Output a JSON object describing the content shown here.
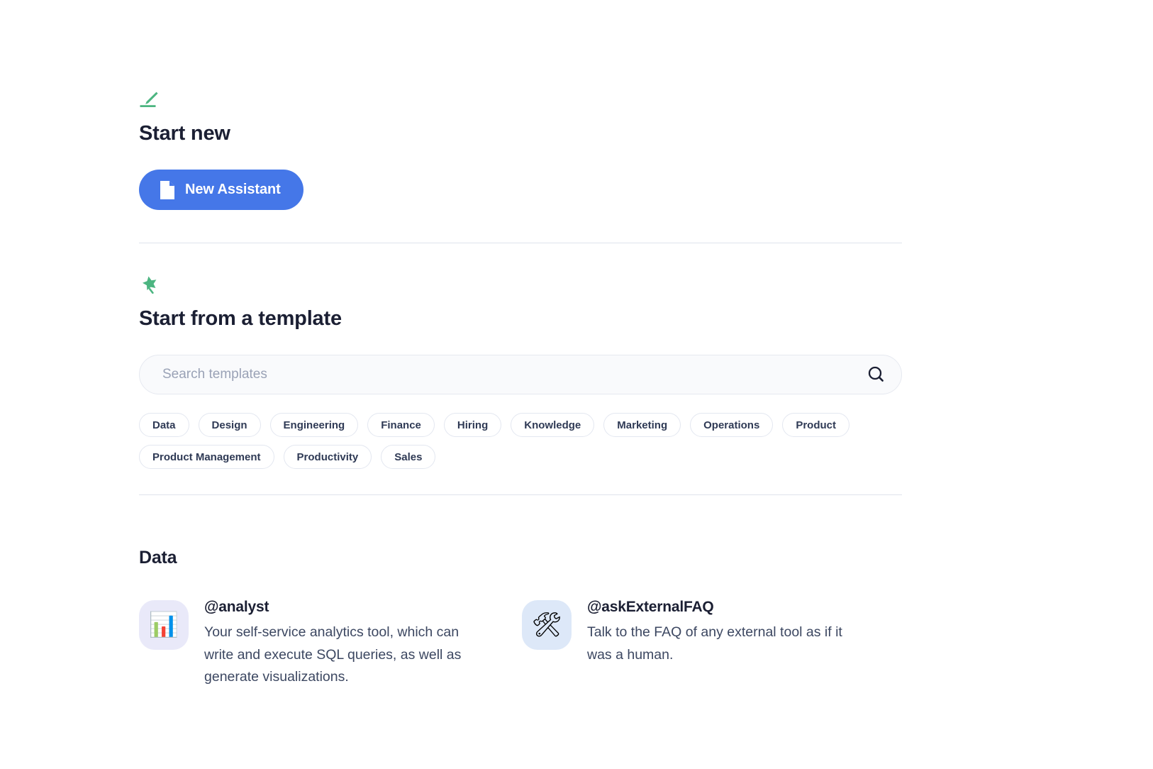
{
  "colors": {
    "accent_blue": "#4577e8",
    "accent_green": "#4cb581",
    "heading": "#1b1f33",
    "body_text": "#3c4761",
    "divider": "#dfe3ec",
    "chip_border": "#e3e7f0",
    "search_bg": "#f9fafc",
    "tile_lavender": "#e9e9f9",
    "tile_blue": "#dde8f8"
  },
  "start_new": {
    "icon": "pencil-icon",
    "title": "Start new",
    "button": {
      "label": "New Assistant",
      "icon": "document-icon"
    }
  },
  "templates": {
    "icon": "magic-wand-icon",
    "title": "Start from a template",
    "search": {
      "placeholder": "Search templates",
      "value": "",
      "icon": "search-icon"
    },
    "chips": [
      {
        "label": "Data"
      },
      {
        "label": "Design"
      },
      {
        "label": "Engineering"
      },
      {
        "label": "Finance"
      },
      {
        "label": "Hiring"
      },
      {
        "label": "Knowledge"
      },
      {
        "label": "Marketing"
      },
      {
        "label": "Operations"
      },
      {
        "label": "Product"
      },
      {
        "label": "Product Management"
      },
      {
        "label": "Productivity"
      },
      {
        "label": "Sales"
      }
    ]
  },
  "categories": [
    {
      "title": "Data",
      "cards": [
        {
          "name": "@analyst",
          "description": "Your self-service analytics tool, which can write and execute SQL queries, as well as generate visualizations.",
          "icon": "bar-chart-emoji",
          "emoji": "📊",
          "tile_color": "#e9e9f9"
        },
        {
          "name": "@askExternalFAQ",
          "description": "Talk to the FAQ of any external tool as if it was a human.",
          "icon": "hammer-and-wrench-emoji",
          "emoji": "🛠",
          "tile_color": "#dde8f8"
        }
      ]
    }
  ]
}
